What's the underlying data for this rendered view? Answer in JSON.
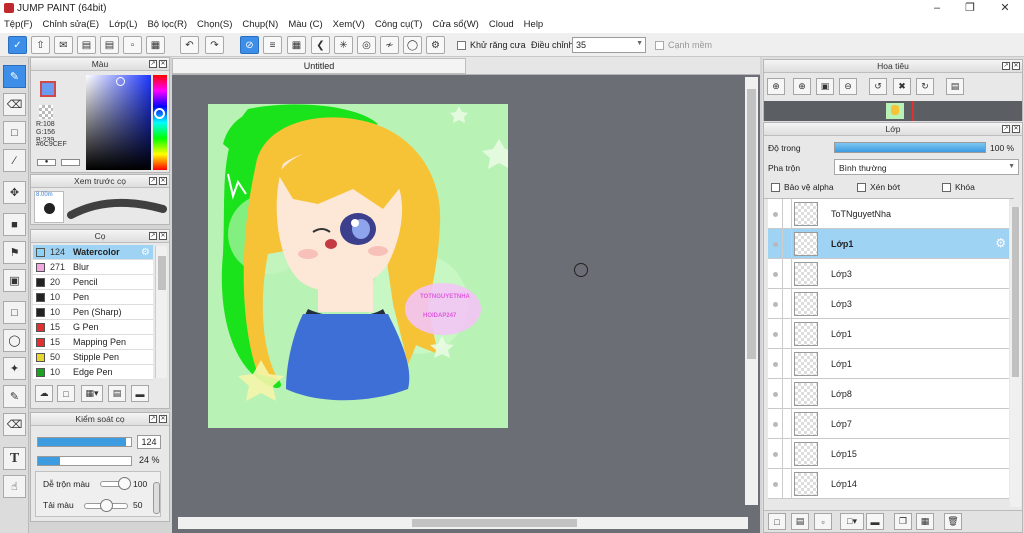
{
  "window": {
    "title": "JUMP PAINT (64bit)"
  },
  "menu": [
    "Tệp(F)",
    "Chỉnh sửa(E)",
    "Lớp(L)",
    "Bộ lọc(R)",
    "Chọn(S)",
    "Chụp(N)",
    "Màu (C)",
    "Xem(V)",
    "Công cụ(T)",
    "Cửa sổ(W)",
    "Cloud",
    "Help"
  ],
  "toolbar": {
    "antialias_label": "Khử răng cưa",
    "adjust_label": "Điều chỉnh",
    "adjust_value": "35",
    "edge_label": "Cạnh mềm"
  },
  "color_panel": {
    "title": "Màu",
    "r": "R:108",
    "g": "G:156",
    "b": "B:239",
    "hex": "#6C9CEF",
    "primary_color": "#6C9CEF",
    "secondary_color": "#FFFFFF"
  },
  "preview_panel": {
    "title": "Xem trước cọ",
    "size_text": "8.00m"
  },
  "brush_panel": {
    "title": "Cọ",
    "items": [
      {
        "size": "124",
        "name": "Watercolor",
        "color": "#8ad3f5",
        "selected": true
      },
      {
        "size": "271",
        "name": "Blur",
        "color": "#f2a7df"
      },
      {
        "size": "20",
        "name": "Pencil",
        "color": "#222222"
      },
      {
        "size": "10",
        "name": "Pen",
        "color": "#222222"
      },
      {
        "size": "10",
        "name": "Pen (Sharp)",
        "color": "#222222"
      },
      {
        "size": "15",
        "name": "G Pen",
        "color": "#e23030"
      },
      {
        "size": "15",
        "name": "Mapping Pen",
        "color": "#e23030"
      },
      {
        "size": "50",
        "name": "Stipple Pen",
        "color": "#e8d630"
      },
      {
        "size": "10",
        "name": "Edge Pen",
        "color": "#19a31e"
      }
    ]
  },
  "brush_control": {
    "title": "Kiểm soát cọ",
    "size_value": "124",
    "size_fill": 0.95,
    "opacity_value": "24 %",
    "opacity_fill": 0.24,
    "blend_label": "Dễ trộn màu",
    "blend_value": "100",
    "mix_label": "Tải màu",
    "mix_value": "50"
  },
  "canvas": {
    "tab_title": "Untitled"
  },
  "navigator": {
    "title": "Hoa tiêu"
  },
  "layer_panel": {
    "title": "Lớp",
    "opacity_label": "Độ trong",
    "opacity_value": "100 %",
    "blend_label": "Pha trộn",
    "blend_value": "Bình thường",
    "protect_alpha": "Bảo vệ alpha",
    "clip": "Xén bớt",
    "lock": "Khóa",
    "layers": [
      {
        "name": "ToTNguyetNha",
        "selected": false
      },
      {
        "name": "Lớp1",
        "selected": true
      },
      {
        "name": "Lớp3",
        "selected": false
      },
      {
        "name": "Lớp3",
        "selected": false
      },
      {
        "name": "Lớp1",
        "selected": false
      },
      {
        "name": "Lớp1",
        "selected": false
      },
      {
        "name": "Lớp8",
        "selected": false
      },
      {
        "name": "Lớp7",
        "selected": false
      },
      {
        "name": "Lớp15",
        "selected": false
      },
      {
        "name": "Lớp14",
        "selected": false
      }
    ]
  },
  "artwork": {
    "tag_line1": "TOTNGUYETNHA",
    "tag_line2": "HOIDAP247"
  }
}
